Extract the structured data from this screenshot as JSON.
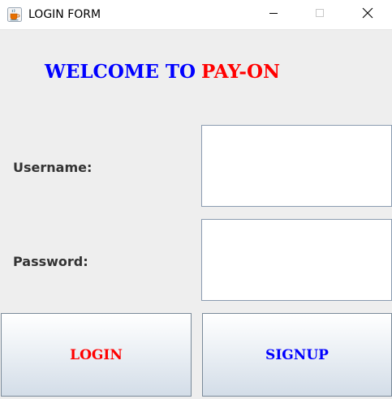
{
  "window": {
    "title": "LOGIN FORM",
    "icons": {
      "app": "java-coffee-cup-icon",
      "minimize": "minimize-icon",
      "maximize": "maximize-icon",
      "close": "close-icon"
    }
  },
  "header": {
    "welcome_text": "WELCOME TO",
    "brand_text": "PAY-ON",
    "welcome_color": "#0000ff",
    "brand_color": "#ff0000"
  },
  "form": {
    "username_label": "Username:",
    "username_value": "",
    "password_label": "Password:",
    "password_value": ""
  },
  "actions": {
    "login_label": "LOGIN",
    "login_color": "#ff0000",
    "signup_label": "SIGNUP",
    "signup_color": "#0000ff"
  }
}
